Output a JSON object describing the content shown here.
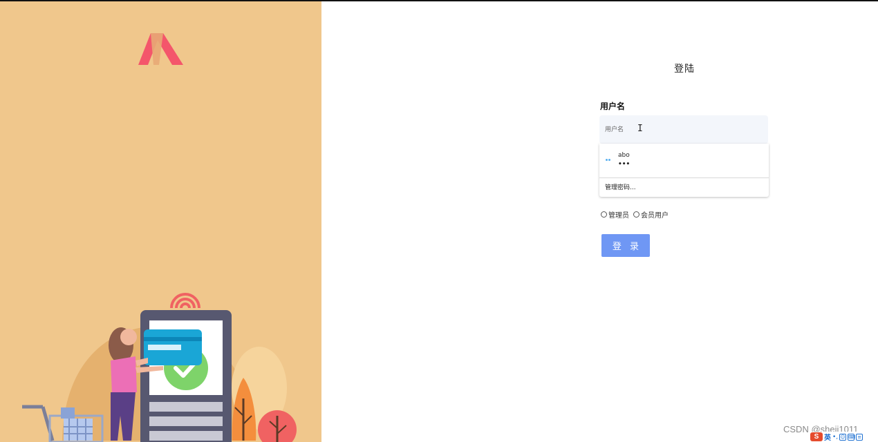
{
  "login": {
    "title": "登陆",
    "username_label": "用户名",
    "username_placeholder": "用户名",
    "login_button": "登 录"
  },
  "autofill": {
    "saved_username": "abo",
    "saved_password_mask": "•••",
    "manage_passwords": "管理密码..."
  },
  "roles": {
    "options": [
      "管理员",
      "会员用户"
    ]
  },
  "watermark": "CSDN @sheji1011",
  "ime": {
    "logo": "S",
    "language": "英"
  },
  "colors": {
    "left_panel_bg": "#f0c78c",
    "login_button_bg": "#6f97f4",
    "input_bg": "#f3f6fb",
    "logo_red": "#f4566b"
  },
  "icons": {
    "logo": "brand-logo-icon",
    "key": "key-icon",
    "text_cursor": "text-cursor-icon"
  }
}
